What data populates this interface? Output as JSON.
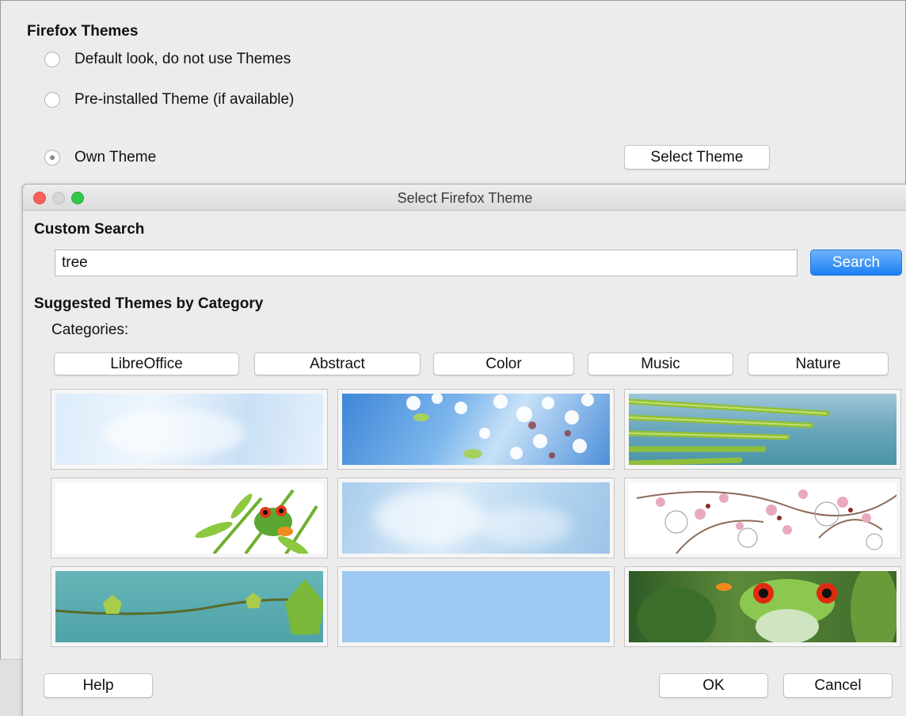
{
  "main": {
    "section_title": "Firefox Themes",
    "options": [
      {
        "label": "Default look, do not use Themes",
        "selected": false
      },
      {
        "label": "Pre-installed Theme (if available)",
        "selected": false
      },
      {
        "label": "Own Theme",
        "selected": true
      }
    ],
    "select_theme_label": "Select Theme"
  },
  "dialog": {
    "title": "Select Firefox Theme",
    "custom_search_title": "Custom Search",
    "search_value": "tree",
    "search_button": "Search",
    "suggested_title": "Suggested Themes by Category",
    "categories_label": "Categories:",
    "categories": [
      "LibreOffice",
      "Abstract",
      "Color",
      "Music",
      "Nature"
    ],
    "themes": [
      {
        "name": "light-clouds-theme"
      },
      {
        "name": "cherry-blossom-sky-theme"
      },
      {
        "name": "palm-leaf-sea-theme"
      },
      {
        "name": "tree-frog-bamboo-theme"
      },
      {
        "name": "sky-clouds-theme"
      },
      {
        "name": "pink-blossom-swirl-theme"
      },
      {
        "name": "vine-leaves-teal-theme"
      },
      {
        "name": "plain-light-blue-theme"
      },
      {
        "name": "red-eyed-tree-frog-theme"
      }
    ],
    "help_button": "Help",
    "ok_button": "OK",
    "cancel_button": "Cancel"
  },
  "colors": {
    "accent": "#1d7ff3",
    "close": "#fc605b",
    "maximize": "#34c84a",
    "background": "#ececec"
  }
}
